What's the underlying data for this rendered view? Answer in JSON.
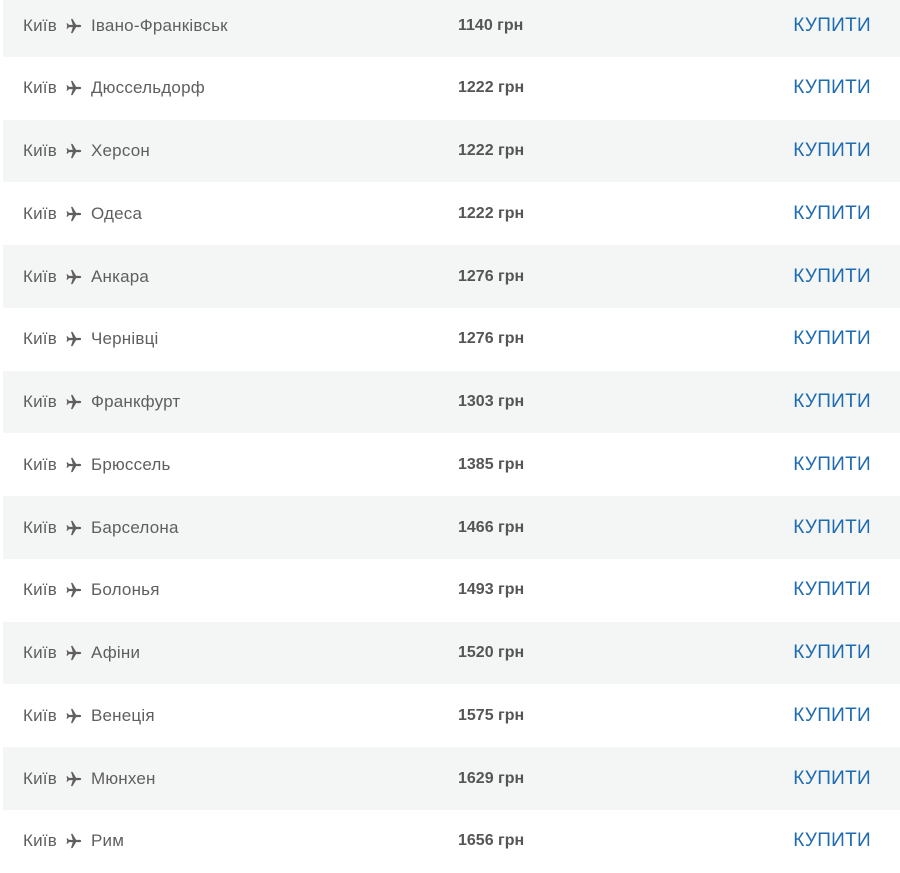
{
  "colors": {
    "shade_row": "#f4f5f5",
    "white_row": "#ffffff",
    "route_text": "#5f5f5f",
    "price_text": "#555555",
    "buy_link": "#1d6bb0"
  },
  "icons": {
    "plane": "airplane-icon"
  },
  "flights": [
    {
      "from": "Київ",
      "to": "Івано-Франківськ",
      "price": "1140 грн",
      "buy_label": "КУПИТИ"
    },
    {
      "from": "Київ",
      "to": "Дюссельдорф",
      "price": "1222 грн",
      "buy_label": "КУПИТИ"
    },
    {
      "from": "Київ",
      "to": "Херсон",
      "price": "1222 грн",
      "buy_label": "КУПИТИ"
    },
    {
      "from": "Київ",
      "to": "Одеса",
      "price": "1222 грн",
      "buy_label": "КУПИТИ"
    },
    {
      "from": "Київ",
      "to": "Анкара",
      "price": "1276 грн",
      "buy_label": "КУПИТИ"
    },
    {
      "from": "Київ",
      "to": "Чернівці",
      "price": "1276 грн",
      "buy_label": "КУПИТИ"
    },
    {
      "from": "Київ",
      "to": "Франкфурт",
      "price": "1303 грн",
      "buy_label": "КУПИТИ"
    },
    {
      "from": "Київ",
      "to": "Брюссель",
      "price": "1385 грн",
      "buy_label": "КУПИТИ"
    },
    {
      "from": "Київ",
      "to": "Барселона",
      "price": "1466 грн",
      "buy_label": "КУПИТИ"
    },
    {
      "from": "Київ",
      "to": "Болонья",
      "price": "1493 грн",
      "buy_label": "КУПИТИ"
    },
    {
      "from": "Київ",
      "to": "Афіни",
      "price": "1520 грн",
      "buy_label": "КУПИТИ"
    },
    {
      "from": "Київ",
      "to": "Венеція",
      "price": "1575 грн",
      "buy_label": "КУПИТИ"
    },
    {
      "from": "Київ",
      "to": "Мюнхен",
      "price": "1629 грн",
      "buy_label": "КУПИТИ"
    },
    {
      "from": "Київ",
      "to": "Рим",
      "price": "1656 грн",
      "buy_label": "КУПИТИ"
    }
  ]
}
